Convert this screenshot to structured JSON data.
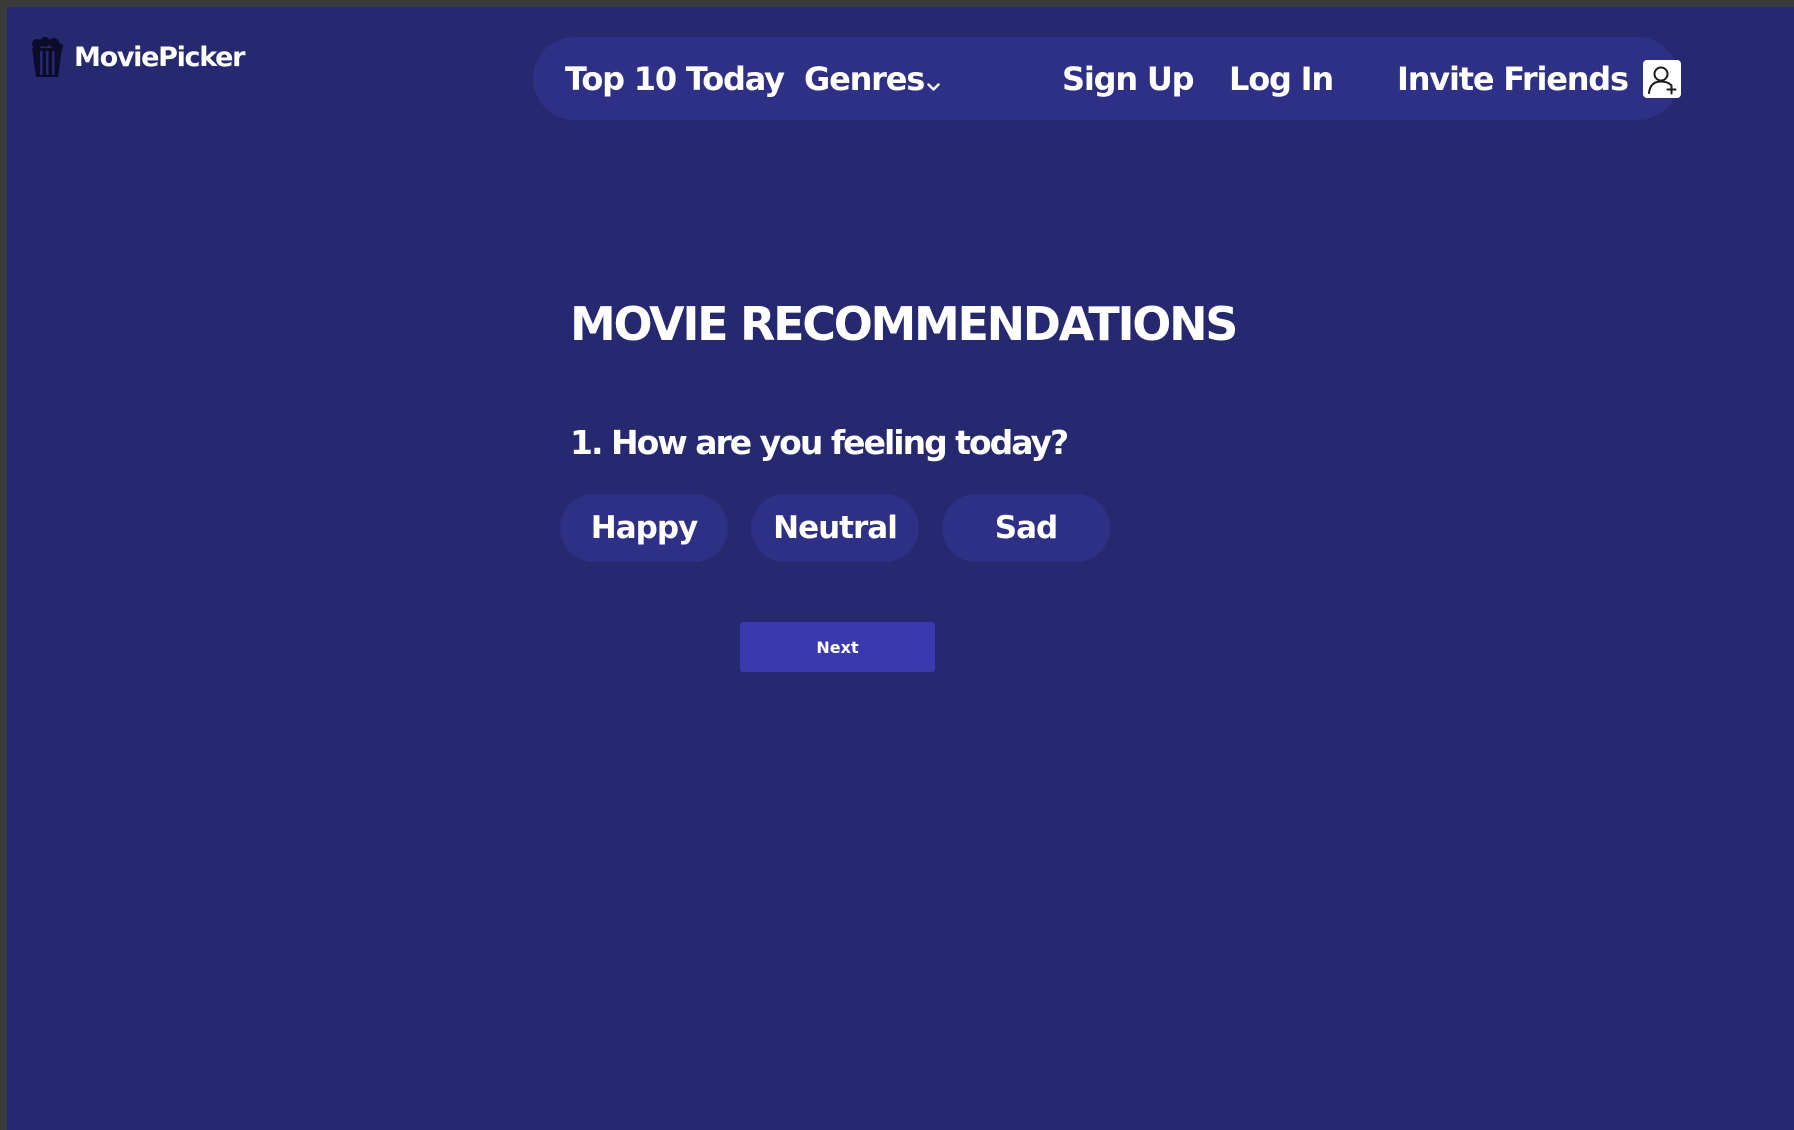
{
  "app": {
    "logo_text": "MoviePicker",
    "logo_icon": "popcorn-icon"
  },
  "nav": {
    "items": [
      {
        "label": "Top 10 Today"
      },
      {
        "label": "Genres",
        "icon": "chevron-down-icon"
      },
      {
        "label": "Sign Up"
      },
      {
        "label": "Log In"
      },
      {
        "label": "Invite Friends",
        "icon": "add-user-icon"
      }
    ]
  },
  "main": {
    "title": "MOVIE RECOMMENDATIONS",
    "question": "1. How are you feeling today?",
    "options": [
      "Happy",
      "Neutral",
      "Sad"
    ],
    "next_label": "Next"
  },
  "colors": {
    "background": "#262870",
    "nav_background": "#2e3085",
    "option_background": "#2e3085",
    "button_background": "#3a3aae",
    "text": "#ffffff"
  }
}
